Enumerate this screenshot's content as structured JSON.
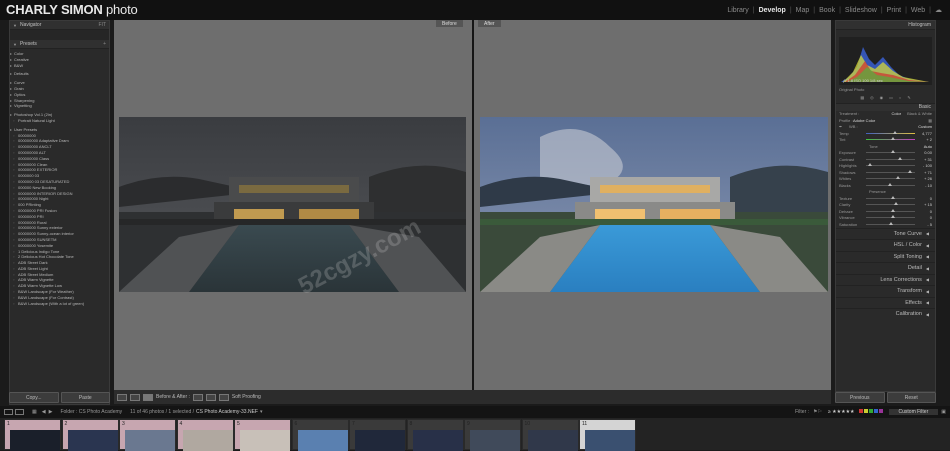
{
  "brand": {
    "name_bold": "CHARLY SIMON",
    "name_rest": " photo"
  },
  "modules": [
    {
      "label": "Library",
      "active": false
    },
    {
      "label": "Develop",
      "active": true
    },
    {
      "label": "Map",
      "active": false
    },
    {
      "label": "Book",
      "active": false
    },
    {
      "label": "Slideshow",
      "active": false
    },
    {
      "label": "Print",
      "active": false
    },
    {
      "label": "Web",
      "active": false
    }
  ],
  "left_panel": {
    "navigator_label": "Navigator",
    "navigator_zoom": "FIT",
    "presets_label": "Presets",
    "preset_items": [
      {
        "t": "Color",
        "k": "folder"
      },
      {
        "t": "Creative",
        "k": "folder"
      },
      {
        "t": "B&W",
        "k": "folder"
      },
      {
        "t": "",
        "k": "gap"
      },
      {
        "t": "Defaults",
        "k": "folder"
      },
      {
        "t": "",
        "k": "gap"
      },
      {
        "t": "Curve",
        "k": "folder"
      },
      {
        "t": "Grain",
        "k": "folder"
      },
      {
        "t": "Optics",
        "k": "folder"
      },
      {
        "t": "Sharpening",
        "k": "folder"
      },
      {
        "t": "Vignetting",
        "k": "folder"
      },
      {
        "t": "",
        "k": "gap"
      },
      {
        "t": "Photoshop Vol.1 (2in)",
        "k": "folder"
      },
      {
        "t": "Portrait Natural Light",
        "k": "item"
      },
      {
        "t": "",
        "k": "gap"
      },
      {
        "t": "User Presets",
        "k": "folder"
      },
      {
        "t": "00000000",
        "k": "item"
      },
      {
        "t": "000000000 Adaptative Dram",
        "k": "item"
      },
      {
        "t": "000000000 ANCLT",
        "k": "item"
      },
      {
        "t": "000000000 ALT",
        "k": "item"
      },
      {
        "t": "000000000 Class",
        "k": "item"
      },
      {
        "t": "00000000 Clean",
        "k": "item"
      },
      {
        "t": "00000000 EXTERIOR",
        "k": "item"
      },
      {
        "t": "0000000 03",
        "k": "item"
      },
      {
        "t": "0000000 03 DESATURATED",
        "k": "item"
      },
      {
        "t": "000000 New Booking",
        "k": "item"
      },
      {
        "t": "00000000 INTERIOR DESIGN",
        "k": "item"
      },
      {
        "t": "000000000 Night",
        "k": "item"
      },
      {
        "t": "000 PRinting",
        "k": "item"
      },
      {
        "t": "00000000 PRI Fusion",
        "k": "item"
      },
      {
        "t": "00000000 PRI",
        "k": "item"
      },
      {
        "t": "00000000 Rural",
        "k": "item"
      },
      {
        "t": "00000000 Sunny exterior",
        "k": "item"
      },
      {
        "t": "00000000 Sunny-ocean interior",
        "k": "item"
      },
      {
        "t": "00000000 SUNSETM",
        "k": "item"
      },
      {
        "t": "00000000 Yosemite",
        "k": "item"
      },
      {
        "t": "1 Delicious Indigo Tone",
        "k": "item"
      },
      {
        "t": "2 Delicious Hot Chocolate Tone",
        "k": "item"
      },
      {
        "t": "ADB Street Dark",
        "k": "item"
      },
      {
        "t": "ADB Street Light",
        "k": "item"
      },
      {
        "t": "ADB Street Medium",
        "k": "item"
      },
      {
        "t": "ADB Warm Vignette",
        "k": "item"
      },
      {
        "t": "ADB Warm Vignette Low",
        "k": "item"
      },
      {
        "t": "B&W Landscape (For Weather)",
        "k": "item"
      },
      {
        "t": "B&W Landscape (For Contrast)",
        "k": "item"
      },
      {
        "t": "B&W Landscape (With a lot of green)",
        "k": "item"
      }
    ],
    "copy_label": "Copy...",
    "paste_label": "Paste"
  },
  "view": {
    "before_label": "Before",
    "after_label": "After"
  },
  "toolbar": {
    "mode_label": "Before & After :",
    "soft_proof_label": "Soft Proofing"
  },
  "right_panel": {
    "histogram_label": "Histogram",
    "histogram_values": "ƒ/ 1.8   ISO 100   1/8 sec",
    "original_photo_label": "Original Photo",
    "basic_label": "Basic",
    "treatment_label": "Treatment :",
    "treatment_color": "Color",
    "treatment_bw": "Black & White",
    "profile_label": "Profile :",
    "profile_value": "Adobe Color",
    "wb_label": "WB :",
    "wb_value": "Custom",
    "temp_label": "Temp",
    "temp_value": "4,777",
    "tint_label": "Tint",
    "tint_value": "+ 2",
    "tone_label": "Tone",
    "auto_label": "Auto",
    "tone_sliders": [
      {
        "label": "Exposure",
        "value": "0.00",
        "pos": 0.5
      },
      {
        "label": "Contrast",
        "value": "+ 31",
        "pos": 0.65
      },
      {
        "label": "Highlights",
        "value": "- 100",
        "pos": 0.05
      },
      {
        "label": "Shadows",
        "value": "+ 71",
        "pos": 0.85
      },
      {
        "label": "Whites",
        "value": "+ 26",
        "pos": 0.62
      },
      {
        "label": "Blacks",
        "value": "- 10",
        "pos": 0.45
      }
    ],
    "presence_label": "Presence",
    "presence_sliders": [
      {
        "label": "Texture",
        "value": "0",
        "pos": 0.5
      },
      {
        "label": "Clarity",
        "value": "+ 15",
        "pos": 0.58
      },
      {
        "label": "Dehaze",
        "value": "0",
        "pos": 0.5
      },
      {
        "label": "Vibrance",
        "value": "0",
        "pos": 0.5
      },
      {
        "label": "Saturation",
        "value": "- 5",
        "pos": 0.47
      }
    ],
    "sections": [
      "Tone Curve",
      "HSL / Color",
      "Split Toning",
      "Detail",
      "Lens Corrections",
      "Transform",
      "Effects",
      "Calibration"
    ],
    "previous_label": "Previous",
    "reset_label": "Reset"
  },
  "filmbar": {
    "folder_text": "Folder : CS Photo Academy",
    "count_text": "11 of 46 photos / 1 selected /",
    "filename": "CS Photo Academy-33.NEF",
    "filter_label": "Filter :",
    "custom_filter": "Custom Filter"
  },
  "filmstrip": {
    "numbers": [
      "1",
      "2",
      "3",
      "4",
      "5",
      "6",
      "7",
      "8",
      "9",
      "10",
      "11"
    ]
  },
  "watermark": "52cgzy.com",
  "colors": {
    "accent_active": "#e6e6e6",
    "panel_bg": "#2a2a2a",
    "canvas_bg": "#6e6e6e"
  }
}
